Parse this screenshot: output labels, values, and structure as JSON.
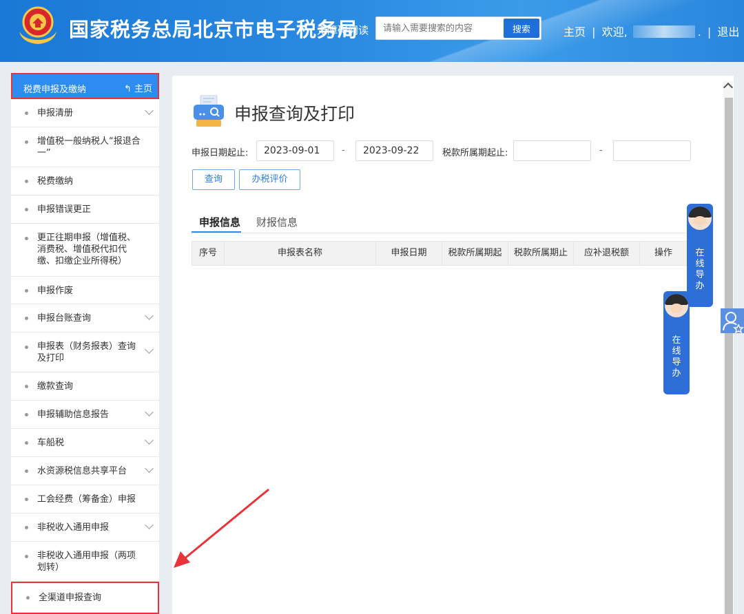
{
  "header": {
    "site_title": "国家税务总局北京市电子税务局",
    "read_mode": "无障碍阅读",
    "search_placeholder": "请输入需要搜索的内容",
    "search_button": "搜索",
    "home_link": "主页",
    "welcome": "欢迎,",
    "separator1": "|",
    "separator2": "|",
    "dot": ".",
    "logout": "退出"
  },
  "sidebar": {
    "title": "税费申报及缴纳",
    "home": "主页",
    "items": [
      {
        "label": "申报清册",
        "chevron": true
      },
      {
        "label": "增值税一般纳税人“报退合一”",
        "chevron": false
      },
      {
        "label": "税费缴纳",
        "chevron": false
      },
      {
        "label": "申报错误更正",
        "chevron": false
      },
      {
        "label": "更正往期申报（增值税、消费税、增值税代扣代缴、扣缴企业所得税）",
        "chevron": false
      },
      {
        "label": "申报作废",
        "chevron": false
      },
      {
        "label": "申报台账查询",
        "chevron": true
      },
      {
        "label": "申报表（财务报表）查询及打印",
        "chevron": true
      },
      {
        "label": "缴款查询",
        "chevron": false
      },
      {
        "label": "申报辅助信息报告",
        "chevron": true
      },
      {
        "label": "车船税",
        "chevron": true
      },
      {
        "label": "水资源税信息共享平台",
        "chevron": true
      },
      {
        "label": "工会经费（筹备金）申报",
        "chevron": false
      },
      {
        "label": "非税收入通用申报",
        "chevron": true
      },
      {
        "label": "非税收入通用申报（两项划转）",
        "chevron": false
      },
      {
        "label": "全渠道申报查询",
        "chevron": false
      }
    ]
  },
  "main": {
    "page_title": "申报查询及打印",
    "filter": {
      "report_date_label": "申报日期起止:",
      "start_date": "2023-09-01",
      "dash": "-",
      "end_date": "2023-09-22",
      "period_label": "税款所属期起止:",
      "period_start": "",
      "period_end": ""
    },
    "buttons": {
      "query": "查询",
      "evaluate": "办税评价"
    },
    "tabs": [
      {
        "label": "申报信息",
        "active": true
      },
      {
        "label": "财报信息",
        "active": false
      }
    ],
    "table_headers": [
      "序号",
      "申报表名称",
      "申报日期",
      "税款所属期起",
      "税款所属期止",
      "应补退税额",
      "操作"
    ]
  },
  "float_widget": {
    "text": [
      "在",
      "线",
      "导",
      "办"
    ]
  },
  "colors": {
    "header_blue": "#1a78d6",
    "sidebar_head": "#2d8cf0",
    "highlight_red": "#e8333a",
    "float_blue": "#2d6fd6"
  }
}
